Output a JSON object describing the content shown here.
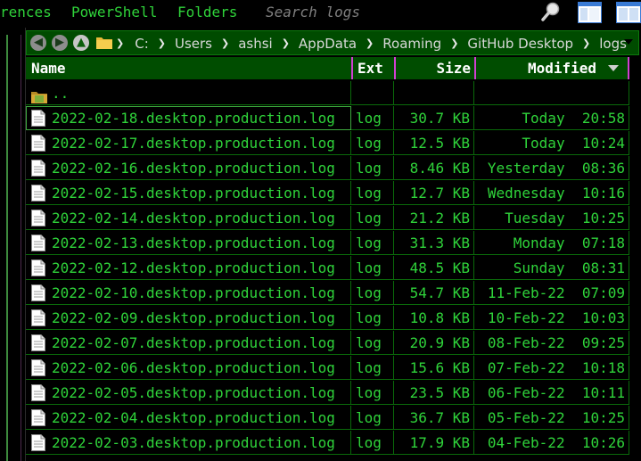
{
  "menubar": {
    "items": [
      {
        "label": "rences",
        "name": "menu-preferences"
      },
      {
        "label": "PowerShell",
        "name": "menu-powershell"
      },
      {
        "label": "Folders",
        "name": "menu-folders"
      }
    ],
    "search_placeholder": "Search logs"
  },
  "toolbar_icons": [
    "search-icon",
    "layout-view-icon",
    "dual-pane-icon"
  ],
  "address": {
    "crumbs": [
      "C:",
      "Users",
      "ashsi",
      "AppData",
      "Roaming",
      "GitHub Desktop",
      "logs"
    ]
  },
  "columns": {
    "name": "Name",
    "ext": "Ext",
    "size": "Size",
    "modified": "Modified"
  },
  "parent_row": {
    "label": ".."
  },
  "files": [
    {
      "name": "2022-02-18.desktop.production.log",
      "ext": "log",
      "size": "30.7 KB",
      "modified": "Today  20:58"
    },
    {
      "name": "2022-02-17.desktop.production.log",
      "ext": "log",
      "size": "12.5 KB",
      "modified": "Today  10:24"
    },
    {
      "name": "2022-02-16.desktop.production.log",
      "ext": "log",
      "size": "8.46 KB",
      "modified": "Yesterday  08:36"
    },
    {
      "name": "2022-02-15.desktop.production.log",
      "ext": "log",
      "size": "12.7 KB",
      "modified": "Wednesday  10:16"
    },
    {
      "name": "2022-02-14.desktop.production.log",
      "ext": "log",
      "size": "21.2 KB",
      "modified": "Tuesday  10:25"
    },
    {
      "name": "2022-02-13.desktop.production.log",
      "ext": "log",
      "size": "31.3 KB",
      "modified": "Monday  07:18"
    },
    {
      "name": "2022-02-12.desktop.production.log",
      "ext": "log",
      "size": "48.5 KB",
      "modified": "Sunday  08:31"
    },
    {
      "name": "2022-02-10.desktop.production.log",
      "ext": "log",
      "size": "54.7 KB",
      "modified": "11-Feb-22  07:09"
    },
    {
      "name": "2022-02-09.desktop.production.log",
      "ext": "log",
      "size": "10.8 KB",
      "modified": "10-Feb-22  10:03"
    },
    {
      "name": "2022-02-07.desktop.production.log",
      "ext": "log",
      "size": "20.9 KB",
      "modified": "08-Feb-22  09:25"
    },
    {
      "name": "2022-02-06.desktop.production.log",
      "ext": "log",
      "size": "15.6 KB",
      "modified": "07-Feb-22  10:18"
    },
    {
      "name": "2022-02-05.desktop.production.log",
      "ext": "log",
      "size": "23.5 KB",
      "modified": "06-Feb-22  10:11"
    },
    {
      "name": "2022-02-04.desktop.production.log",
      "ext": "log",
      "size": "36.7 KB",
      "modified": "05-Feb-22  10:25"
    },
    {
      "name": "2022-02-03.desktop.production.log",
      "ext": "log",
      "size": "17.9 KB",
      "modified": "04-Feb-22  10:26"
    }
  ],
  "colors": {
    "text_green": "#2fd33a",
    "header_bg": "#004d00",
    "grid_line": "#0a6a0a",
    "column_divider": "#d040d0"
  }
}
